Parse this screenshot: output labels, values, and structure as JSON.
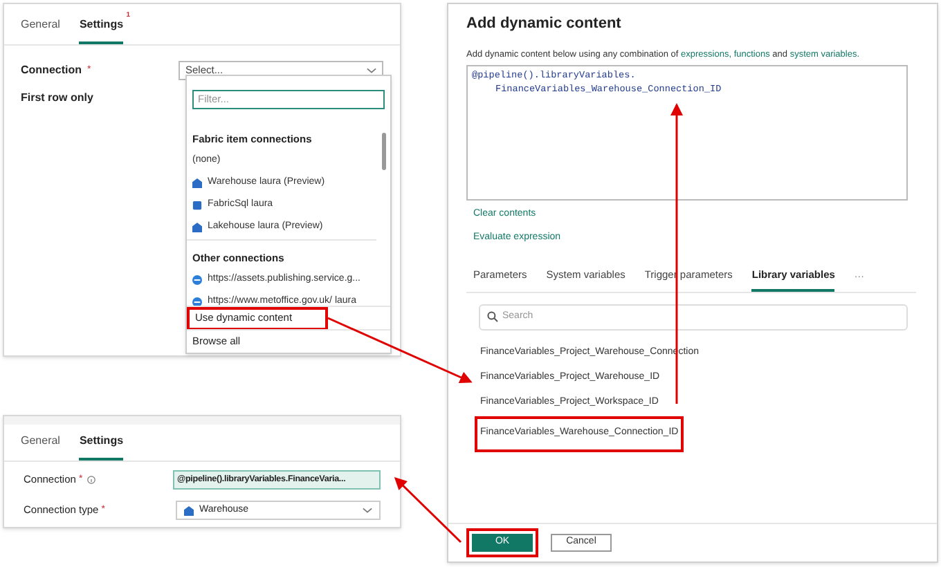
{
  "settings_panel": {
    "tabs": [
      {
        "label": "General",
        "selected": false
      },
      {
        "label": "Settings",
        "selected": true,
        "badge": "1"
      }
    ],
    "fields": [
      {
        "label": "Connection",
        "required_mark": "*",
        "kind": "select",
        "value": "Select..."
      },
      {
        "label": "First row only",
        "kind": "none"
      }
    ],
    "dropdown": {
      "filter_placeholder": "Filter...",
      "sections": [
        {
          "heading": "Fabric item connections",
          "items": [
            {
              "label": "(none)",
              "kind": "none"
            },
            {
              "label": "Warehouse laura (Preview)",
              "kind": "warehouse"
            },
            {
              "label": "FabricSql laura",
              "kind": "database"
            },
            {
              "label": "Lakehouse laura (Preview)",
              "kind": "warehouse"
            }
          ]
        },
        {
          "heading": "Other connections",
          "items": [
            {
              "label": "https://assets.publishing.service.g...",
              "kind": "web"
            },
            {
              "label": "https://www.metoffice.gov.uk/ laura",
              "kind": "web"
            }
          ]
        }
      ],
      "actions": [
        {
          "label": "Use dynamic content",
          "highlighted": true
        },
        {
          "label": "Browse all",
          "highlighted": false
        }
      ]
    }
  },
  "dynamic_content_dialog": {
    "title": "Add dynamic content",
    "description": [
      {
        "text": "Add dynamic content below using any combination of "
      },
      {
        "text": "expressions, ",
        "link": true
      },
      {
        "text": "functions",
        "link": true
      },
      {
        "text": " and "
      },
      {
        "text": "system variables.",
        "link": true
      }
    ],
    "expression_lines": [
      "@pipeline().libraryVariables.",
      "FinanceVariables_Warehouse_Connection_ID"
    ],
    "links": [
      "Clear contents",
      "Evaluate expression"
    ],
    "tabs": [
      {
        "label": "Parameters",
        "selected": false
      },
      {
        "label": "System variables",
        "selected": false
      },
      {
        "label": "Trigger parameters",
        "selected": false
      },
      {
        "label": "Library variables",
        "selected": true
      }
    ],
    "more_button": "···",
    "search": {
      "placeholder": "Search"
    },
    "variables": [
      {
        "label": "FinanceVariables_Project_Warehouse_Connection",
        "highlighted": false
      },
      {
        "label": "FinanceVariables_Project_Warehouse_ID",
        "highlighted": false
      },
      {
        "label": "FinanceVariables_Project_Workspace_ID",
        "highlighted": false
      },
      {
        "label": "FinanceVariables_Warehouse_Connection_ID",
        "highlighted": true
      }
    ],
    "buttons": [
      {
        "label": "OK",
        "kind": "primary",
        "highlighted": true
      },
      {
        "label": "Cancel",
        "kind": "secondary",
        "highlighted": false
      }
    ]
  },
  "result_panel": {
    "tabs": [
      {
        "label": "General",
        "selected": false
      },
      {
        "label": "Settings",
        "selected": true
      }
    ],
    "fields": [
      {
        "label": "Connection",
        "required_mark": "*",
        "info": true,
        "kind": "expression",
        "value": "@pipeline().libraryVariables.FinanceVaria..."
      },
      {
        "label": "Connection type",
        "required_mark": "*",
        "kind": "select",
        "value": {
          "text": "Warehouse",
          "kind": "warehouse"
        }
      }
    ]
  }
}
